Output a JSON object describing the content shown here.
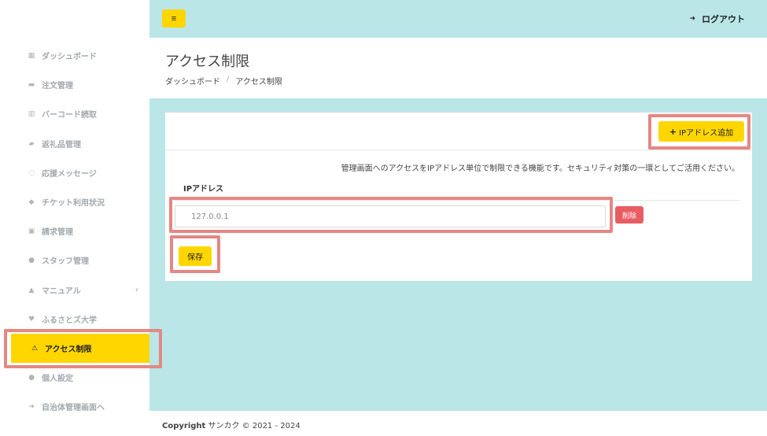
{
  "header": {
    "menu_icon": "≡",
    "logout_label": "ログアウト"
  },
  "sidebar": {
    "items": [
      {
        "label": "ダッシュボード",
        "icon": "▦"
      },
      {
        "label": "注文管理",
        "icon": "▬"
      },
      {
        "label": "バーコード読取",
        "icon": "▥"
      },
      {
        "label": "返礼品管理",
        "icon": "▰"
      },
      {
        "label": "応援メッセージ",
        "icon": "◌"
      },
      {
        "label": "チケット利用状況",
        "icon": "◆"
      },
      {
        "label": "請求管理",
        "icon": "▣"
      },
      {
        "label": "スタッフ管理",
        "icon": "●"
      },
      {
        "label": "マニュアル",
        "icon": "▲",
        "chevron": "‹"
      },
      {
        "label": "ふるさとズ大学",
        "icon": "♥"
      },
      {
        "label": "アクセス制限",
        "icon": "⚠"
      },
      {
        "label": "個人設定",
        "icon": "●"
      },
      {
        "label": "自治体管理画面へ",
        "icon": "➜"
      }
    ]
  },
  "page": {
    "title": "アクセス制限",
    "breadcrumb": {
      "home": "ダッシュボード",
      "separator": "/",
      "current": "アクセス制限"
    }
  },
  "card": {
    "add_button_icon": "+",
    "add_button_label": "IPアドレス追加",
    "description": "管理画面へのアクセスをIPアドレス単位で制限できる機能です。セキュリティ対策の一環としてご活用ください。",
    "column_header": "IPアドレス",
    "ip_value": "127.0.0.1",
    "delete_label": "削除",
    "save_label": "保存"
  },
  "footer": {
    "copyright_bold": "Copyright",
    "copyright_text": " サンカク © 2021 - 2024"
  }
}
